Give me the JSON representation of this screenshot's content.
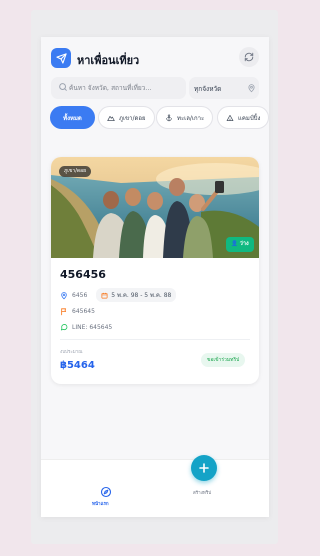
{
  "app": {
    "title": "หาเพื่อนเที่ยว",
    "refresh_icon": "refresh-icon",
    "logo_icon": "send-icon",
    "accent": "#3b7bf2"
  },
  "search": {
    "placeholder": "ค้นหา จังหวัด, สถานที่เที่ยว...",
    "value": ""
  },
  "province_filter": {
    "label": "ทุกจังหวัด"
  },
  "categories": [
    {
      "label": "ทั้งหมด",
      "active": true
    },
    {
      "label": "ภูเขา/ดอย",
      "icon": "mountain-icon",
      "active": false
    },
    {
      "label": "ทะเล/เกาะ",
      "icon": "anchor-icon",
      "active": false
    },
    {
      "label": "แคมป์ปิ้ง",
      "icon": "tent-icon",
      "active": false
    }
  ],
  "trip": {
    "tag": "ภูเขา/ดอย",
    "status": "ว่าง",
    "title": "456456",
    "location": "6456",
    "date": "5 พ.ค. 98 - 5 พ.ค. 88",
    "meeting": "645645",
    "line": "LINE: 645645",
    "budget_label": "งบประมาณ",
    "budget": "฿5464",
    "join_label": "ขอเข้าร่วมทริป"
  },
  "nav": {
    "home_label": "หน้าแรก",
    "create_label": "สร้างทริป"
  },
  "colors": {
    "status_green": "#10b981",
    "budget_blue": "#2563eb",
    "fab": "#14a3c7"
  }
}
